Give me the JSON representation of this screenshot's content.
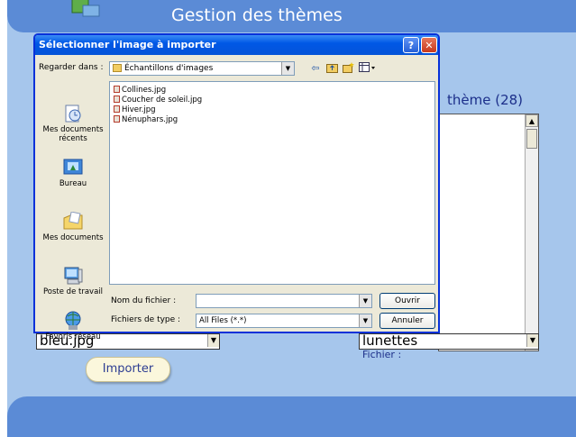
{
  "app": {
    "title": "Gestion des thèmes",
    "theme_count_label": "thème (28)",
    "background_select_value": "bleu.jpg",
    "icon_select_value": "lunettes",
    "file_label": "Fichier :",
    "import_button": "Importer"
  },
  "dialog": {
    "title": "Sélectionner l'image à importer",
    "help_button": "?",
    "close_button": "✕",
    "look_in_label": "Regarder dans :",
    "look_in_value": "Échantillons d'images",
    "places": [
      {
        "label": "Mes documents récents",
        "icon": "recent-documents-icon"
      },
      {
        "label": "Bureau",
        "icon": "desktop-icon"
      },
      {
        "label": "Mes documents",
        "icon": "my-documents-icon"
      },
      {
        "label": "Poste de travail",
        "icon": "my-computer-icon"
      },
      {
        "label": "Favoris réseau",
        "icon": "network-places-icon"
      }
    ],
    "files": [
      "Collines.jpg",
      "Coucher de soleil.jpg",
      "Hiver.jpg",
      "Nénuphars.jpg"
    ],
    "file_name_label": "Nom du fichier :",
    "file_name_value": "",
    "file_type_label": "Fichiers de type :",
    "file_type_value": "All Files (*.*)",
    "open_button": "Ouvrir",
    "cancel_button": "Annuler"
  },
  "colors": {
    "app_background": "#a6c6ec",
    "header_band": "#5b8bd6",
    "dialog_title_bar": "#0058e6",
    "dialog_body": "#ece9d8"
  }
}
